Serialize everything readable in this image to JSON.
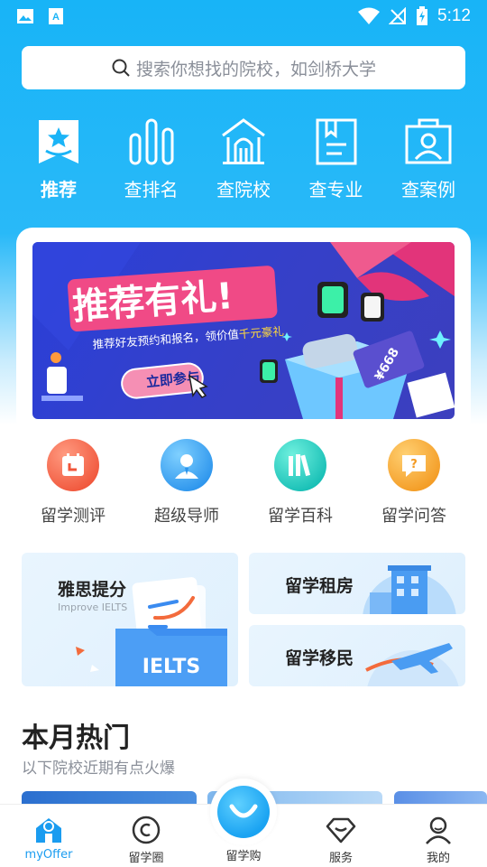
{
  "status_bar": {
    "time": "5:12"
  },
  "search": {
    "placeholder": "搜索你想找的院校，如剑桥大学"
  },
  "top_nav": [
    {
      "label": "推荐",
      "icon": "recommend-icon",
      "active": true
    },
    {
      "label": "查排名",
      "icon": "ranking-icon"
    },
    {
      "label": "查院校",
      "icon": "school-icon"
    },
    {
      "label": "查专业",
      "icon": "major-icon"
    },
    {
      "label": "查案例",
      "icon": "case-icon"
    }
  ],
  "banner": {
    "title": "推荐有礼!",
    "subtitle_a": "推荐好友预约和报名，领价值",
    "subtitle_b": "千元豪礼",
    "cta": "立即参与",
    "voucher": "¥668"
  },
  "services": [
    {
      "label": "留学测评",
      "icon": "assessment-icon",
      "color": "#f26b4f"
    },
    {
      "label": "超级导师",
      "icon": "mentor-icon",
      "color": "#3ba3f0"
    },
    {
      "label": "留学百科",
      "icon": "encyclopedia-icon",
      "color": "#1fc6c0"
    },
    {
      "label": "留学问答",
      "icon": "qa-icon",
      "color": "#f5a02c"
    }
  ],
  "tiles": {
    "ielts": {
      "title": "雅思提分",
      "subtitle": "Improve IELTS",
      "badge": "IELTS"
    },
    "rent": {
      "title": "留学租房"
    },
    "immigration": {
      "title": "留学移民"
    }
  },
  "hot": {
    "title": "本月热门",
    "subtitle": "以下院校近期有点火爆"
  },
  "tabbar": [
    {
      "label": "myOffer",
      "icon": "home-icon",
      "active": true
    },
    {
      "label": "留学圈",
      "icon": "circle-icon"
    },
    {
      "label": "留学购",
      "icon": "shop-icon"
    },
    {
      "label": "服务",
      "icon": "service-icon"
    },
    {
      "label": "我的",
      "icon": "profile-icon"
    }
  ],
  "colors": {
    "primary": "#1aa3f2",
    "active_tab": "#1a9cf0"
  }
}
